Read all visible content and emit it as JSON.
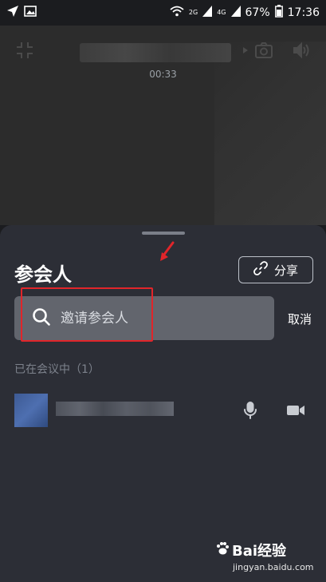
{
  "status_bar": {
    "network_labels": [
      "2G",
      "4G"
    ],
    "battery": "67%",
    "time": "17:36"
  },
  "meeting": {
    "elapsed_time": "00:33"
  },
  "sheet": {
    "title": "参会人",
    "share_label": "分享",
    "search_placeholder": "邀请参会人",
    "cancel_label": "取消",
    "section_label": "已在会议中（1）"
  },
  "watermark": {
    "brand": "Bai经验",
    "url": "jingyan.baidu.com"
  },
  "colors": {
    "highlight": "#e1252a",
    "sheet_bg": "#2c2e36",
    "search_bg": "#62656d"
  }
}
